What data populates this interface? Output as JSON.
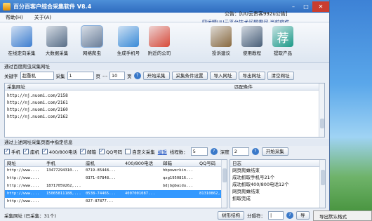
{
  "title": "百分百客户综合采集软件  V8.4",
  "menu": {
    "help": "帮助(H)",
    "about": "关于(A)"
  },
  "notice": {
    "line1": "公告：[UU云贵客992u公告]",
    "line2": "四远精UU云平台技术问题需问,当前软件..."
  },
  "toolbar": {
    "items": [
      {
        "label": "在线定向采集",
        "icon": "clock-icon",
        "color": "#3f7fd0"
      },
      {
        "label": "大数据采集",
        "icon": "database-icon",
        "color": "#5a6f88"
      },
      {
        "label": "网络爬虫",
        "icon": "magnifier-icon",
        "color": "#6c7f99"
      },
      {
        "label": "生成手机号",
        "icon": "phone-icon",
        "color": "#3a8bd8"
      },
      {
        "label": "附近的公司",
        "icon": "map-icon",
        "color": "#d94b3a"
      },
      {
        "label": "投诉建议",
        "icon": "feedback-icon",
        "color": "#8a6a3f"
      },
      {
        "label": "使用教程",
        "icon": "teacher-icon",
        "color": "#4a5f78"
      },
      {
        "label": "提取产品",
        "icon": "jian-icon",
        "color": "#1d9a88",
        "glyph": "荐"
      }
    ]
  },
  "baidu": {
    "section": "通过百度爬虫采集网址",
    "keyword_label": "关键字",
    "keyword_value": "超重机",
    "collect_label": "采集",
    "page_from": "1",
    "page_label": "页",
    "dash": "---",
    "page_to": "10",
    "page_label2": "页",
    "buttons": [
      "开始采集",
      "采集条件设置",
      "导入网址",
      "导出网址",
      "清空网址"
    ]
  },
  "url_table": {
    "headers": [
      "采集网址",
      "匹配条件"
    ],
    "rows": [
      "http://nj.nuomi.com/2158",
      "http://nj.nuomi.com/2161",
      "http://nj.nuomi.com/2160",
      "http://nj.nuomi.com/2162"
    ]
  },
  "extract": {
    "section": "通过上述网址采集页面中指定信息",
    "checks": [
      {
        "label": "手机",
        "on": true
      },
      {
        "label": "座机",
        "on": true
      },
      {
        "label": "400/800电话",
        "on": true
      },
      {
        "label": "邮箱",
        "on": true
      },
      {
        "label": "QQ号码",
        "on": true
      },
      {
        "label": "自定义采集",
        "on": false
      }
    ],
    "edit_link": "编辑",
    "threads_label": "线程数：",
    "threads_value": "5",
    "depth_label": "深度",
    "depth_value": "2",
    "start_button": "开始采集"
  },
  "result_table": {
    "headers": [
      "网址",
      "手机",
      "座机",
      "400/800电话",
      "邮箱",
      "QQ号码"
    ],
    "rows": [
      [
        "http://www....",
        "13477294310...",
        "0719-85448...",
        "",
        "hbpowerkin...",
        ""
      ],
      [
        "http://www....",
        "",
        "0371-67848...",
        "",
        "qzg1950816...",
        ""
      ],
      [
        "http://www....",
        "18717059262,...",
        "",
        "",
        "bdjb@baidu...",
        ""
      ],
      [
        "http://www....",
        "15065811188,...",
        "0538-74465...",
        "4007001087...",
        "",
        "81310862,..."
      ],
      [
        "http://www....",
        "",
        "027-87877...",
        "",
        "",
        ""
      ]
    ]
  },
  "log": {
    "header": "日志",
    "lines": [
      "网页爬蛛结束",
      "成功抓取手机号21个",
      "成功抓取400/800电话12个",
      "网页爬蛛结束",
      "抓取完成"
    ]
  },
  "status": {
    "collected": "采集网址  (已采集：31个)",
    "tree_button": "树形结构",
    "delimiter_label": "分隔符：",
    "delimiter_value": "|",
    "export_button": "导"
  },
  "taskbar": {
    "label": "导出默认格式"
  }
}
